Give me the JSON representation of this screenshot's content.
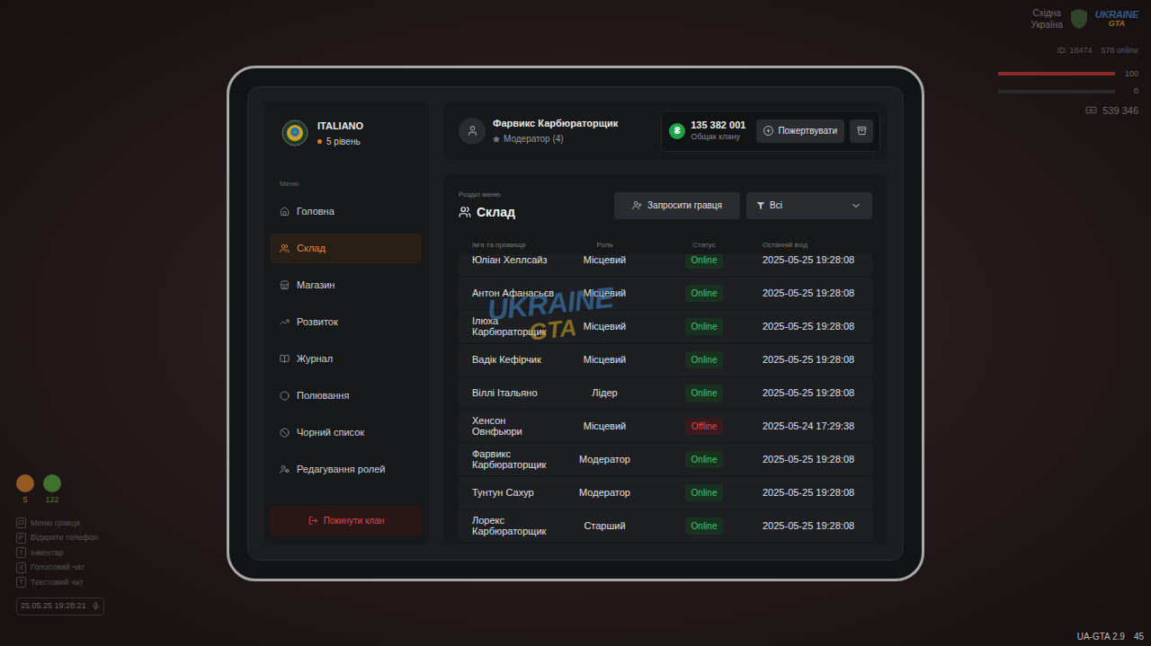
{
  "hud": {
    "region": {
      "line1": "Східна",
      "line2": "Україна"
    },
    "logo": {
      "line1": "UKRAINE",
      "line2": "GTA"
    },
    "server": {
      "id": "ID: 18474",
      "online": "578 online"
    },
    "health": {
      "value": "100",
      "level": 1
    },
    "armor": {
      "value": "0",
      "level": 0
    },
    "money": "539 346",
    "counters": [
      {
        "value": "5",
        "color": "#c7782a"
      },
      {
        "value": "122",
        "color": "#4f9a3a"
      }
    ],
    "hotkeys": [
      {
        "key": "O",
        "label": "Меню гравця"
      },
      {
        "key": "P",
        "label": "Відкрити телефон"
      },
      {
        "key": "I",
        "label": "Інвентар"
      },
      {
        "key": "X",
        "label": "Голосовий чат"
      },
      {
        "key": "T",
        "label": "Текстовий чат"
      }
    ],
    "clock": "25.05.25 19:28:21",
    "version": "UA-GTA 2.9",
    "fps": "45"
  },
  "sidebar": {
    "clan": "ITALIANO",
    "level": "5 рівень",
    "menu_label": "Меню",
    "items": [
      {
        "label": "Головна",
        "selected": false
      },
      {
        "label": "Склад",
        "selected": true
      },
      {
        "label": "Магазин",
        "selected": false
      },
      {
        "label": "Розвиток",
        "selected": false
      },
      {
        "label": "Журнал",
        "selected": false
      },
      {
        "label": "Полювання",
        "selected": false
      },
      {
        "label": "Чорний список",
        "selected": false
      },
      {
        "label": "Редагування ролей",
        "selected": false
      }
    ],
    "leave_button": "Покинути клан"
  },
  "header": {
    "user_name": "Фарвикс Карбюраторщик",
    "user_role": "Модератор (4)",
    "currency": "₴",
    "treasury": "135 382 001",
    "treasury_label": "Общак клану",
    "donate_button": "Пожертвувати"
  },
  "section": {
    "caption": "Розділ меню",
    "title": "Склад",
    "invite_button": "Запросити гравця",
    "filter": "Всі"
  },
  "watermark": {
    "line1": "UKRAINE",
    "line2": "GTA"
  },
  "table": {
    "columns": [
      "Ім'я та прізвище",
      "Роль",
      "Статус",
      "Останній вхід"
    ],
    "rows": [
      {
        "name": "Юліан Хеллсайз",
        "role": "Місцевий",
        "status": "Online",
        "online": true,
        "last_login": "2025-05-25 19:28:08"
      },
      {
        "name": "Антон Афанасьєв",
        "role": "Місцевий",
        "status": "Online",
        "online": true,
        "last_login": "2025-05-25 19:28:08"
      },
      {
        "name": "Ілюха Карбюраторщик",
        "role": "Місцевий",
        "status": "Online",
        "online": true,
        "last_login": "2025-05-25 19:28:08"
      },
      {
        "name": "Вадік Кефірчик",
        "role": "Місцевий",
        "status": "Online",
        "online": true,
        "last_login": "2025-05-25 19:28:08"
      },
      {
        "name": "Віллі Італьяно",
        "role": "Лідер",
        "status": "Online",
        "online": true,
        "last_login": "2025-05-25 19:28:08"
      },
      {
        "name": "Хенсон Овнфьюри",
        "role": "Місцевий",
        "status": "Offline",
        "online": false,
        "last_login": "2025-05-24 17:29:38"
      },
      {
        "name": "Фарвикс Карбюраторщик",
        "role": "Модератор",
        "status": "Online",
        "online": true,
        "last_login": "2025-05-25 19:28:08"
      },
      {
        "name": "Тунтун Сахур",
        "role": "Модератор",
        "status": "Online",
        "online": true,
        "last_login": "2025-05-25 19:28:08"
      },
      {
        "name": "Лорекс Карбюраторщик",
        "role": "Старший",
        "status": "Online",
        "online": true,
        "last_login": "2025-05-25 19:28:08"
      }
    ]
  }
}
